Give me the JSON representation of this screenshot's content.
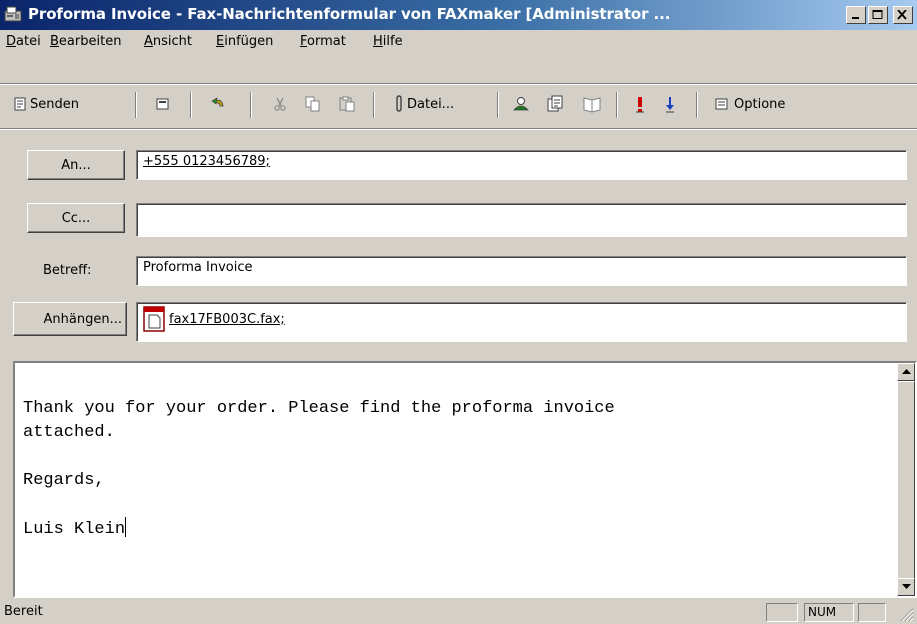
{
  "window": {
    "title": "Proforma Invoice - Fax-Nachrichtenformular von FAXmaker [Administrator ...",
    "titlebar_gradient": [
      "#0a246a",
      "#a6caf0"
    ],
    "icons": [
      "fax-app-icon",
      "minimize-icon",
      "maximize-icon",
      "close-icon"
    ]
  },
  "menu": {
    "items": [
      {
        "accel": "D",
        "rest": "atei"
      },
      {
        "accel": "B",
        "rest": "earbeiten"
      },
      {
        "accel": "A",
        "rest": "nsicht"
      },
      {
        "accel": "E",
        "rest": "infügen"
      },
      {
        "accel": "F",
        "rest": "ormat"
      },
      {
        "accel": "H",
        "rest": "ilfe"
      }
    ]
  },
  "toolbar": {
    "send_label": "Senden",
    "attach_label": "Datei...",
    "options_label": "Optione"
  },
  "header": {
    "to_button": "An...",
    "to_value": "+555 0123456789;",
    "cc_button": "Cc...",
    "cc_value": "",
    "subject_label": "Betreff:",
    "subject_value": "Proforma Invoice",
    "attach_button": "Anhängen...",
    "attachment_name": "fax17FB003C.fax;"
  },
  "body": {
    "lines": [
      "Thank you for your order. Please find the proforma invoice",
      "attached.",
      "",
      "Regards,",
      "",
      "Luis Klein"
    ]
  },
  "status": {
    "text": "Bereit",
    "num": "NUM"
  }
}
